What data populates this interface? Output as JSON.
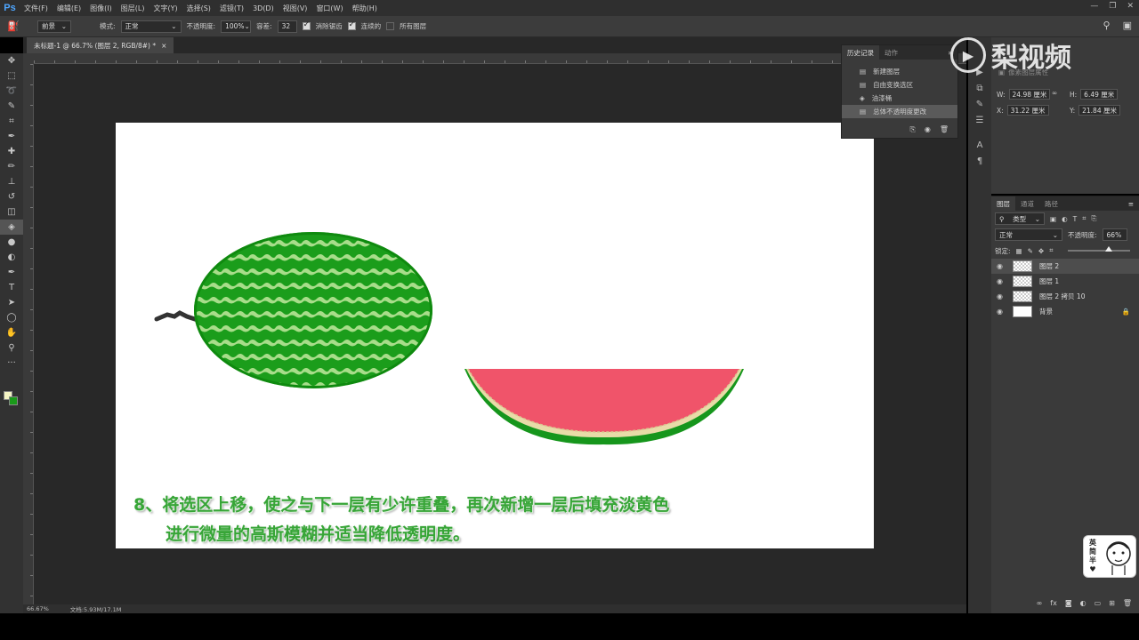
{
  "app": {
    "logo": "Ps"
  },
  "menu": [
    "文件(F)",
    "编辑(E)",
    "图像(I)",
    "图层(L)",
    "文字(Y)",
    "选择(S)",
    "滤镜(T)",
    "3D(D)",
    "视图(V)",
    "窗口(W)",
    "帮助(H)"
  ],
  "options": {
    "fill_source": "前景",
    "mode_label": "模式:",
    "mode_value": "正常",
    "opacity_label": "不透明度:",
    "opacity_value": "100%",
    "tolerance_label": "容差:",
    "tolerance_value": "32",
    "antialias_label": "消除锯齿",
    "contiguous_label": "连续的",
    "all_layers_label": "所有图层"
  },
  "document": {
    "tab_title": "未标题-1 @ 66.7% (图层 2, RGB/8#) *"
  },
  "status": {
    "zoom": "66.67%",
    "doc_size": "文档:5.93M/17.1M"
  },
  "history": {
    "tabs": [
      "历史记录",
      "动作"
    ],
    "items": [
      {
        "label": "新建图层",
        "icon": "layer-icon"
      },
      {
        "label": "自由变换选区",
        "icon": "layer-icon"
      },
      {
        "label": "油漆桶",
        "icon": "bucket-icon"
      },
      {
        "label": "总体不透明度更改",
        "icon": "layer-icon",
        "selected": true
      }
    ]
  },
  "properties": {
    "header_note": "像素图层属性",
    "w_label": "W:",
    "w_value": "24.98 厘米",
    "h_label": "H:",
    "h_value": "6.49 厘米",
    "x_label": "X:",
    "x_value": "31.22 厘米",
    "y_label": "Y:",
    "y_value": "21.84 厘米"
  },
  "layers_panel": {
    "tabs": [
      "图层",
      "通道",
      "路径"
    ],
    "filter_kind": "类型",
    "blend_mode": "正常",
    "opacity_label": "不透明度:",
    "opacity_value": "66%",
    "lock_label": "锁定:",
    "opacity_slider_fraction": 0.66,
    "layers": [
      {
        "name": "图层 2",
        "selected": true,
        "thumb": "transparent"
      },
      {
        "name": "图层 1",
        "selected": false,
        "thumb": "transparent"
      },
      {
        "name": "图层 2 拷贝 10",
        "selected": false,
        "thumb": "transparent"
      },
      {
        "name": "背景",
        "selected": false,
        "thumb": "white",
        "locked": true
      }
    ]
  },
  "canvas": {
    "instruction_line1": "8、将选区上移，使之与下一层有少许重叠，再次新增一层后填充淡黄色",
    "instruction_line2": "进行微量的高斯模糊并适当降低透明度。"
  },
  "watermark": {
    "text": "梨视频"
  },
  "sticker": {
    "chars": [
      "英",
      "简",
      "半"
    ]
  },
  "colors": {
    "foreground": "#f4f4c4",
    "background": "#1a9a1a",
    "watermelon_flesh": "#f0546a",
    "instruction_text": "#37a537"
  }
}
